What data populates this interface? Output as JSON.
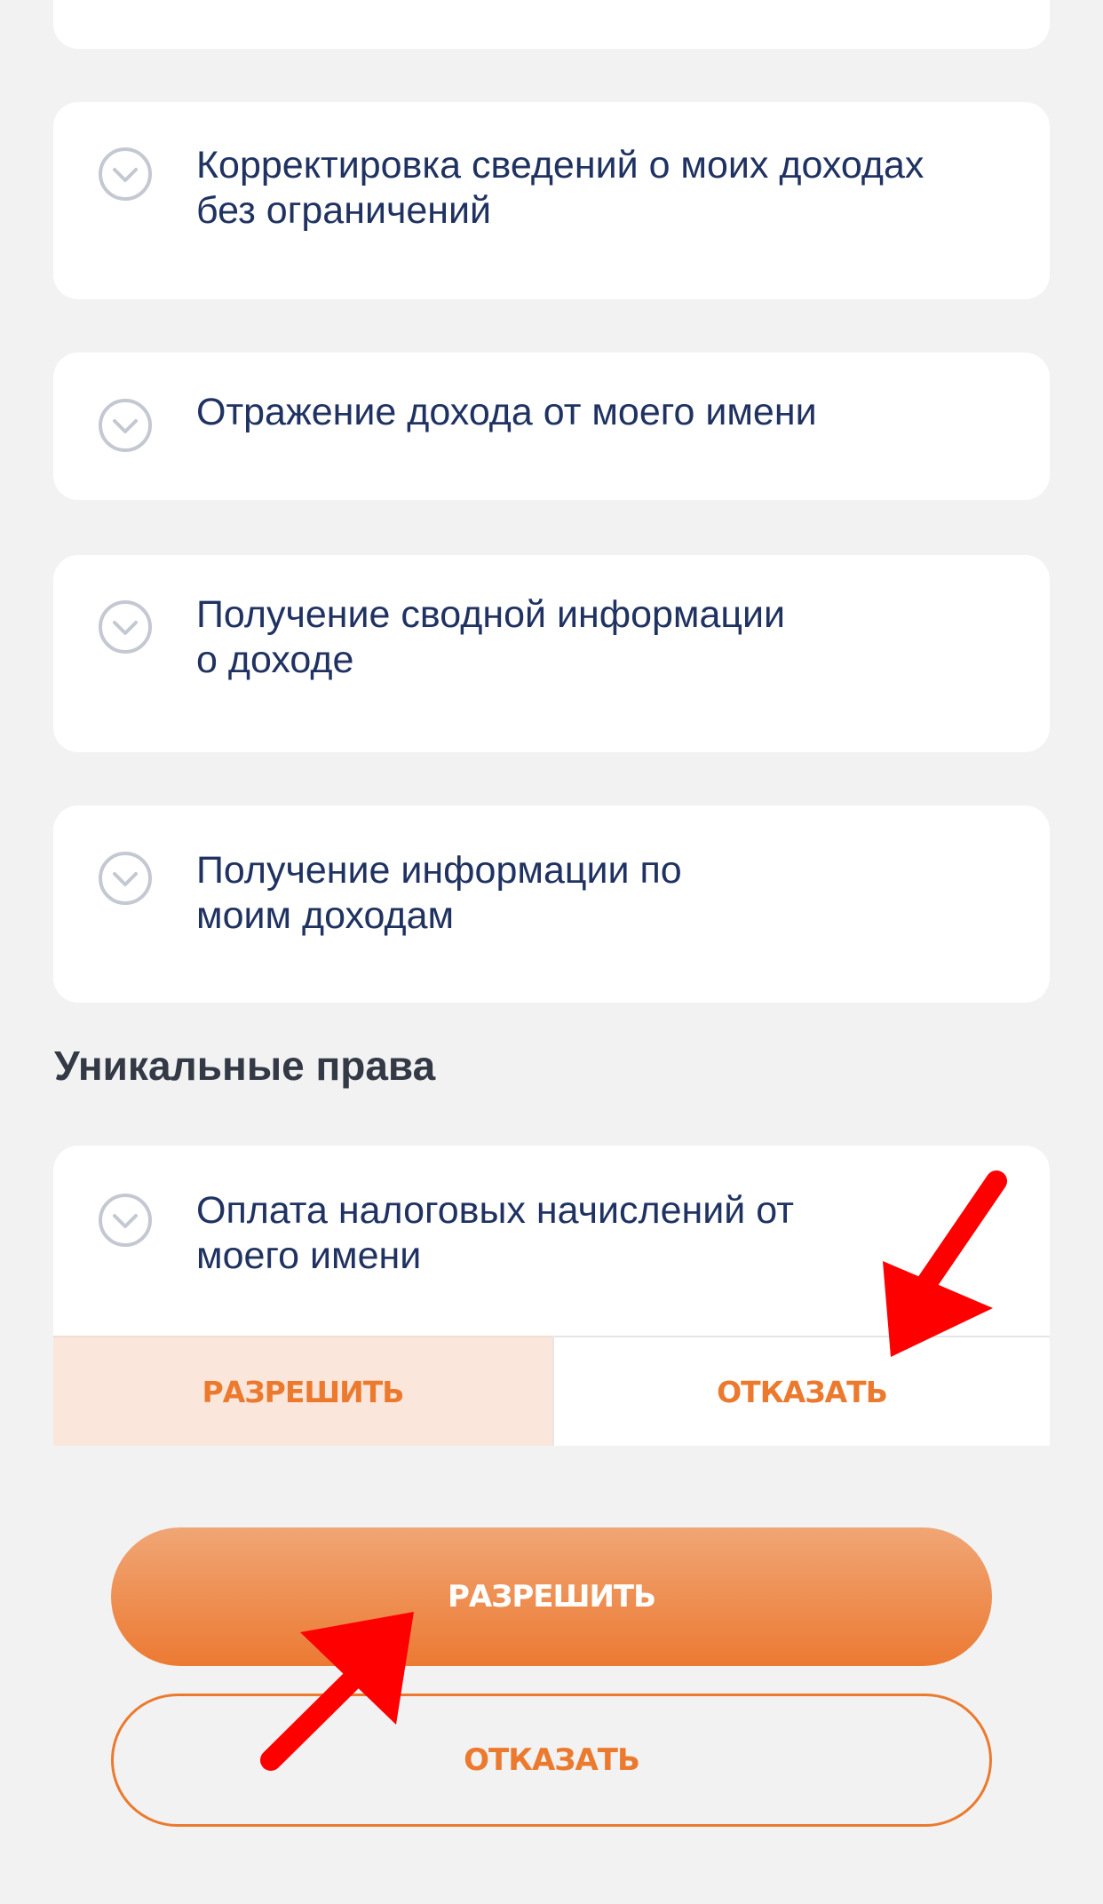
{
  "cards": [
    {
      "title": "Корректировка сведений о моих доходах\nбез ограничений",
      "icon": "chevron-down-circle-icon"
    },
    {
      "title": "Отражение дохода от моего имени",
      "icon": "chevron-down-circle-icon"
    },
    {
      "title": "Получение сводной информации\nо доходе",
      "icon": "chevron-down-circle-icon"
    },
    {
      "title": "Получение информации по\nмоим доходам",
      "icon": "chevron-down-circle-icon"
    }
  ],
  "unique_rights": {
    "heading": "Уникальные права",
    "card": {
      "title": "Оплата налоговых начислений от\nмоего имени",
      "icon": "chevron-down-circle-icon",
      "allow_label": "РАЗРЕШИТЬ",
      "deny_label": "ОТКАЗАТЬ"
    }
  },
  "footer": {
    "allow_label": "РАЗРЕШИТЬ",
    "deny_label": "ОТКАЗАТЬ"
  },
  "colors": {
    "background": "#f2f2f2",
    "card": "#ffffff",
    "title_text": "#1f3261",
    "accent_orange": "#ec7a2e",
    "segment_selected_bg": "#fbe6dc",
    "annotation_arrow": "#ff0000"
  }
}
